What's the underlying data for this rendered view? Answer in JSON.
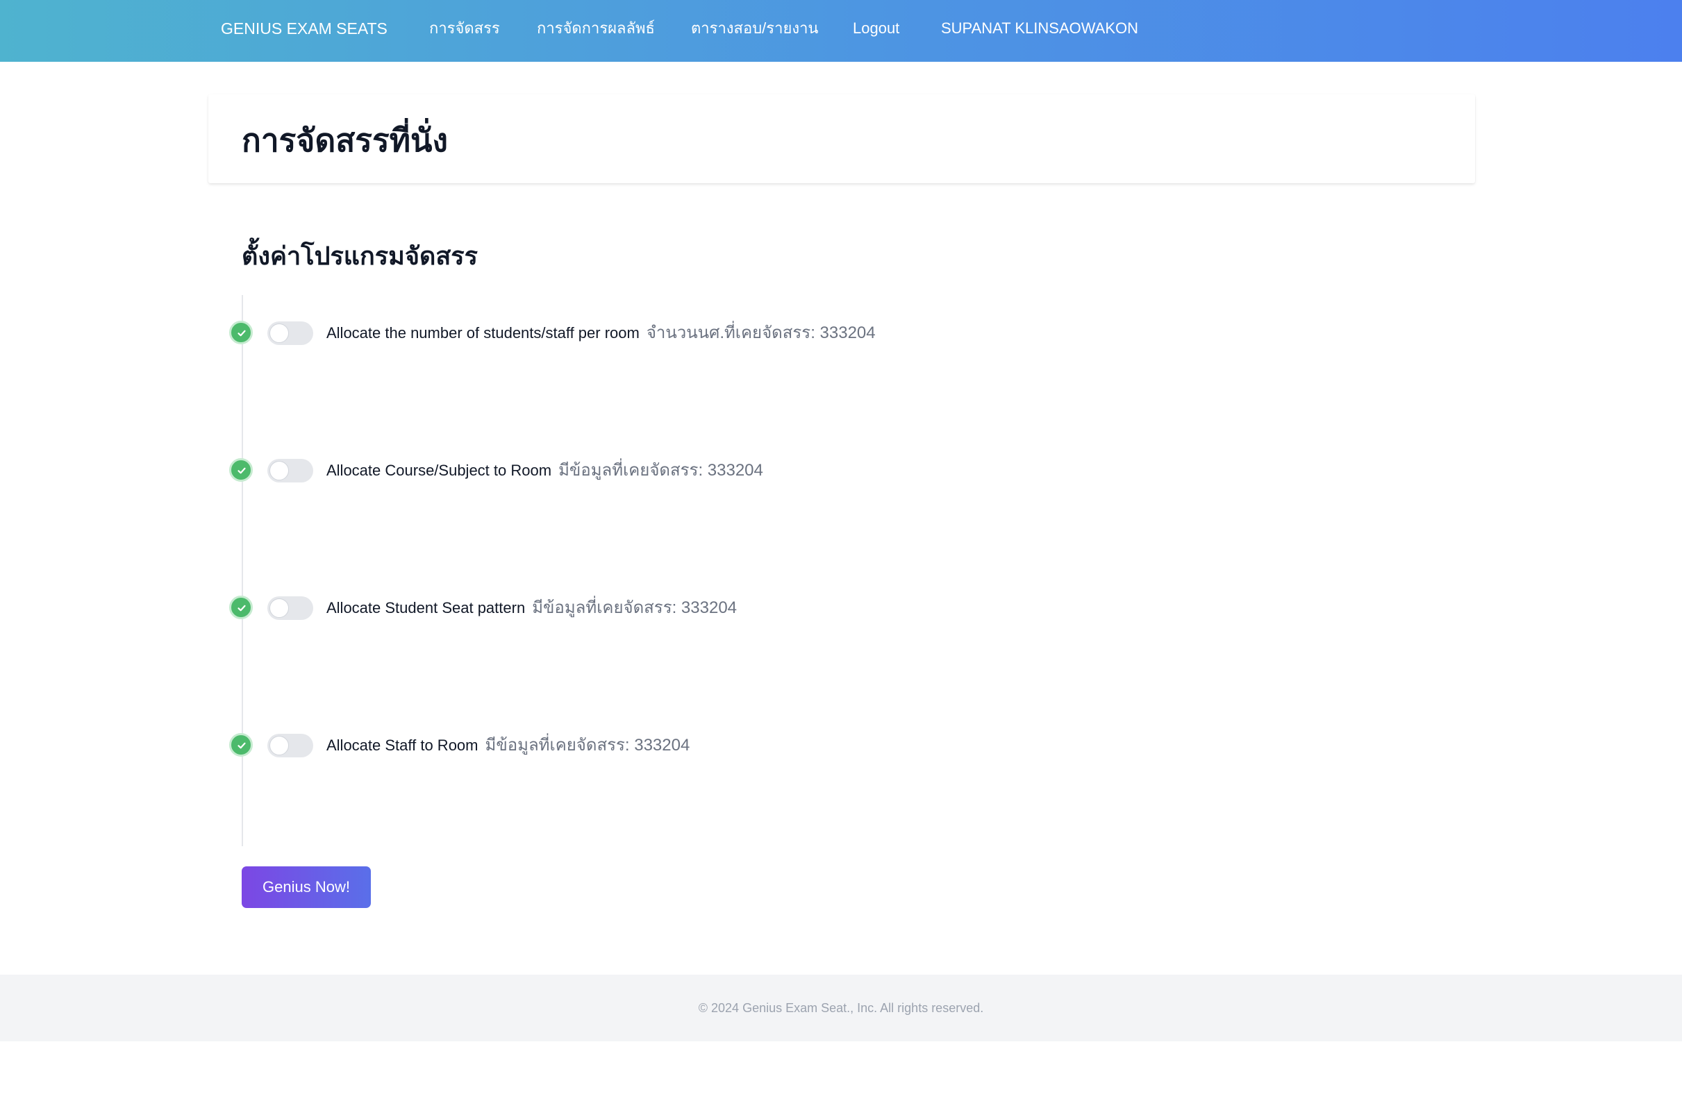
{
  "navbar": {
    "brand": "GENIUS EXAM SEATS",
    "items": [
      {
        "label": "การจัดสรร"
      },
      {
        "label": "การจัดการผลลัพธ์"
      },
      {
        "label": "ตารางสอบ/รายงาน"
      },
      {
        "label": "Logout"
      },
      {
        "label": "SUPANAT KLINSAOWAKON"
      }
    ]
  },
  "page": {
    "title": "การจัดสรรที่นั่ง"
  },
  "settings": {
    "section_title": "ตั้งค่าโปรแกรมจัดสรร",
    "steps": [
      {
        "label": "Allocate the number of students/staff per room",
        "info": "จำนวนนศ.ที่เคยจัดสรร: 333204",
        "completed": true,
        "enabled": false
      },
      {
        "label": "Allocate Course/Subject to Room",
        "info": "มีข้อมูลที่เคยจัดสรร: 333204",
        "completed": true,
        "enabled": false
      },
      {
        "label": "Allocate Student Seat pattern",
        "info": "มีข้อมูลที่เคยจัดสรร: 333204",
        "completed": true,
        "enabled": false
      },
      {
        "label": "Allocate Staff to Room",
        "info": "มีข้อมูลที่เคยจัดสรร: 333204",
        "completed": true,
        "enabled": false
      }
    ],
    "action_button": "Genius Now!"
  },
  "footer": {
    "text": "© 2024 Genius Exam Seat., Inc. All rights reserved."
  },
  "colors": {
    "navbar_gradient_start": "#4fb3cf",
    "navbar_gradient_end": "#4c80ee",
    "step_complete": "#4cba6b",
    "button_gradient_start": "#7c47e4",
    "button_gradient_end": "#5a6fe9",
    "footer_bg": "#f3f4f6"
  },
  "icons": {
    "step_status": "check-circle-icon"
  }
}
